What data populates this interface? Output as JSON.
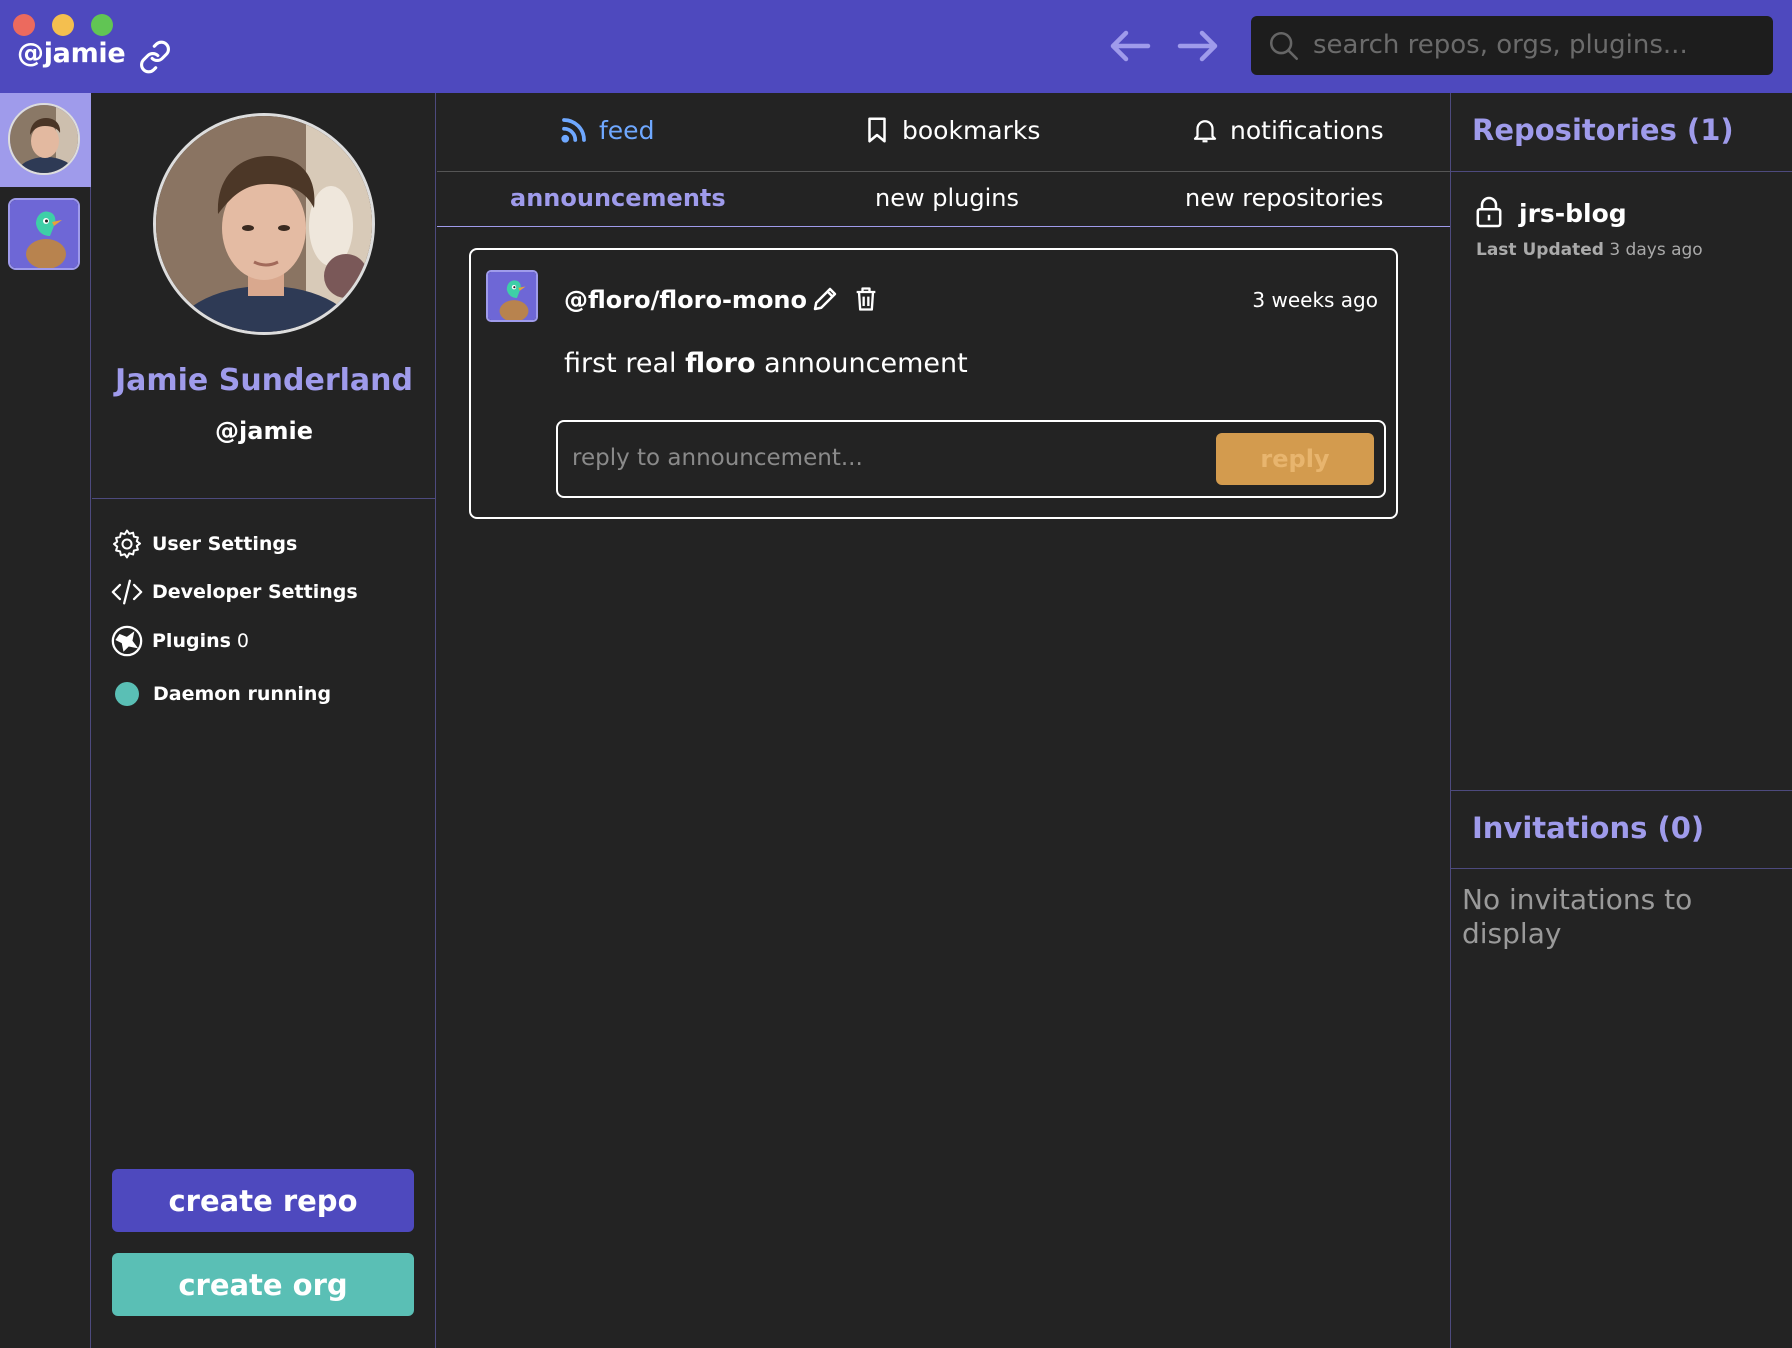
{
  "titlebar": {
    "handle": "@jamie",
    "search_placeholder": "search repos, orgs, plugins..."
  },
  "profile": {
    "full_name": "Jamie Sunderland",
    "username": "@jamie",
    "menu": [
      {
        "label": "User Settings"
      },
      {
        "label": "Developer Settings"
      },
      {
        "label": "Plugins",
        "count": "0"
      },
      {
        "label": "Daemon running"
      }
    ],
    "create_repo": "create repo",
    "create_org": "create org"
  },
  "feed": {
    "tabs": {
      "feed": "feed",
      "bookmarks": "bookmarks",
      "notifications": "notifications"
    },
    "subtabs": {
      "announcements": "announcements",
      "new_plugins": "new plugins",
      "new_repositories": "new repositories"
    },
    "announcement": {
      "repo": "@floro/floro-mono",
      "time": "3 weeks ago",
      "message_prefix": "first real ",
      "message_bold": "floro",
      "message_suffix": " announcement",
      "reply_placeholder": "reply to announcement...",
      "reply_button": "reply"
    }
  },
  "sidebar_right": {
    "repositories_title": "Repositories (1)",
    "repos": [
      {
        "name": "jrs-blog",
        "updated_label": "Last Updated",
        "updated_value": "3 days ago"
      }
    ],
    "invitations_title": "Invitations (0)",
    "invitations_empty": "No invitations to display"
  },
  "colors": {
    "brand": "#4E49BE",
    "accent": "#9F9BEB",
    "teal": "#5ABFB5",
    "orange": "#D39B4E",
    "background": "#232323"
  }
}
